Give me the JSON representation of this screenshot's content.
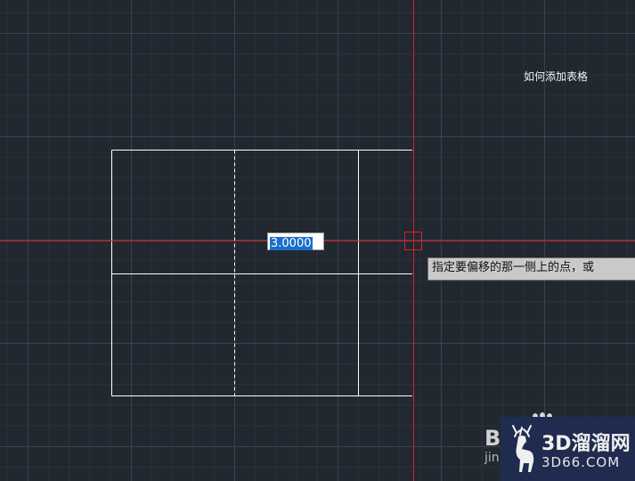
{
  "title_annotation": "如何添加表格",
  "dynamic_input": {
    "value": "3.0000"
  },
  "tooltip": {
    "text": "指定要偏移的那一侧上的点，或"
  },
  "watermark": {
    "partial_logo_big": "B",
    "partial_logo_small": "jin",
    "brand_main": "3D溜溜网",
    "brand_sub": "3D66.COM"
  },
  "colors": {
    "background": "#212830",
    "crosshair": "#d6202a",
    "geometry": "#ffffff",
    "selection": "#1a6fcc",
    "tooltip_bg": "#c9c9c9",
    "brand_bg": "#1f2c50"
  },
  "icons": {
    "crosshair_cursor": "crosshair-pickbox-icon",
    "brand": "deer-icon",
    "paw": "paw-icon"
  }
}
